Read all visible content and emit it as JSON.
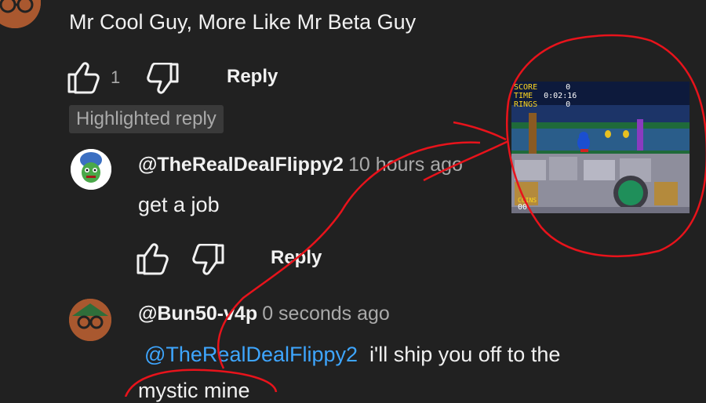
{
  "top_comment": {
    "text": "Mr Cool Guy, More Like Mr Beta Guy",
    "like_count": "1",
    "reply_label": "Reply",
    "badge": "Highlighted reply"
  },
  "replies": [
    {
      "author": "@TheRealDealFlippy2",
      "timestamp": "10 hours ago",
      "text": "get a job",
      "reply_label": "Reply"
    },
    {
      "author": "@Bun50-v4p",
      "timestamp": "0 seconds ago",
      "mention": "@TheRealDealFlippy2",
      "text_line1": "i'll ship you off to the",
      "text_line2": "mystic mine"
    }
  ],
  "game_screenshot": {
    "hud_score_label": "SCORE",
    "hud_score_value": "0",
    "hud_time_label": "TIME",
    "hud_time_value": "0:02:16",
    "hud_rings_label": "RINGS",
    "hud_rings_value": "0",
    "hud_coins_label": "COINS",
    "hud_coins_value": "00"
  },
  "colors": {
    "background": "#212121",
    "text": "#f1f1f1",
    "secondary_text": "#aaaaaa",
    "mention": "#3ea6ff",
    "annotation": "#e8131b"
  }
}
